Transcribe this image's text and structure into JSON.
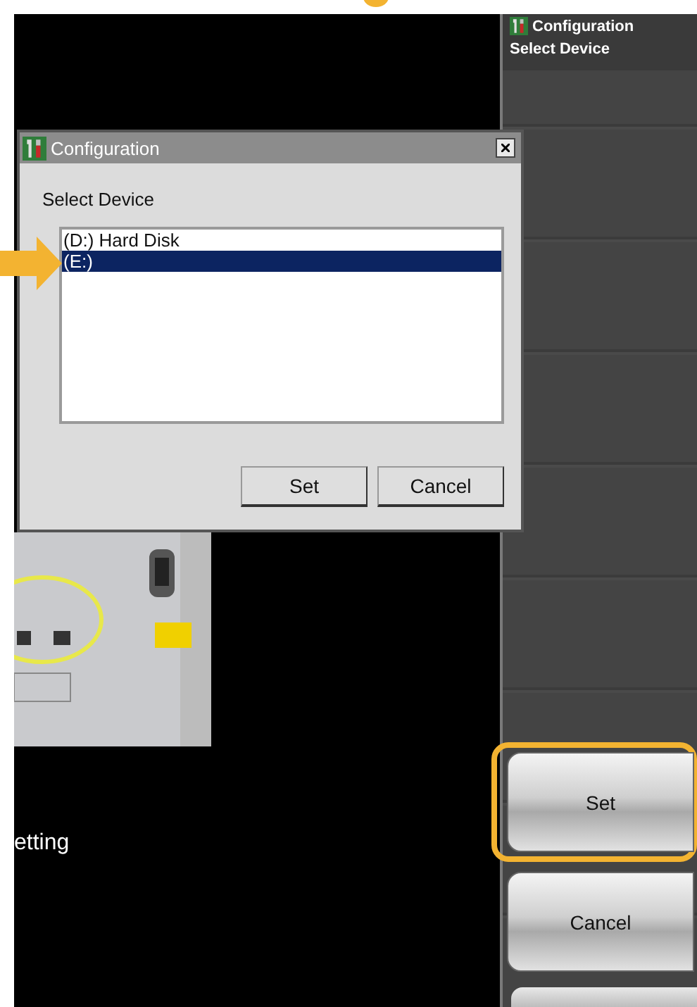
{
  "dialog": {
    "title": "Configuration",
    "prompt": "Select Device",
    "devices": [
      {
        "label": "(D:) Hard Disk",
        "selected": false
      },
      {
        "label": "(E:)",
        "selected": true
      }
    ],
    "buttons": [
      {
        "label": "Set"
      },
      {
        "label": "Cancel"
      }
    ]
  },
  "background": {
    "caption": "etting"
  },
  "side_panel": {
    "title": "Configuration",
    "subtitle": "Select Device",
    "buttons": [
      {
        "label": "Set",
        "highlighted": true
      },
      {
        "label": "Cancel",
        "highlighted": false
      }
    ]
  }
}
